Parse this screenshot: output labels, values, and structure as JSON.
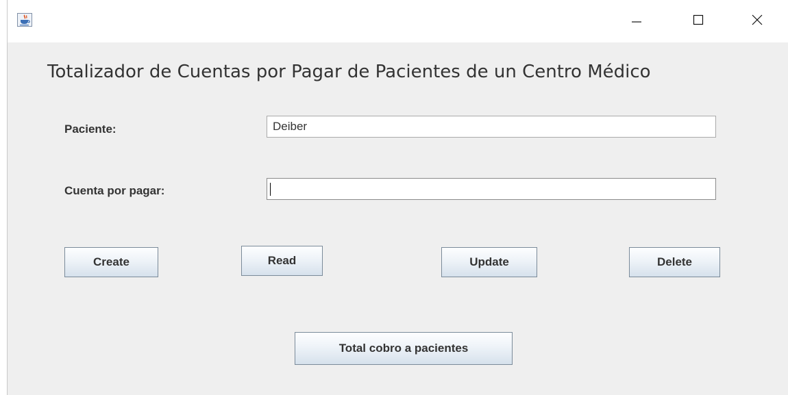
{
  "window": {
    "title": ""
  },
  "title_bar": {
    "app_icon": "java-coffee-cup-icon",
    "minimize_icon": "minimize-icon",
    "maximize_icon": "maximize-icon",
    "close_icon": "close-icon"
  },
  "form": {
    "heading": "Totalizador de Cuentas por Pagar de Pacientes de un Centro Médico",
    "paciente_label": "Paciente:",
    "paciente_value": "Deiber",
    "cuenta_label": "Cuenta por pagar:",
    "cuenta_value": ""
  },
  "buttons": {
    "create": "Create",
    "read": "Read",
    "update": "Update",
    "delete": "Delete",
    "total": "Total cobro a pacientes"
  },
  "colors": {
    "panel_background": "#efefef",
    "title_bar_background": "#ffffff",
    "button_border": "#7a8a99",
    "text": "#333333"
  }
}
